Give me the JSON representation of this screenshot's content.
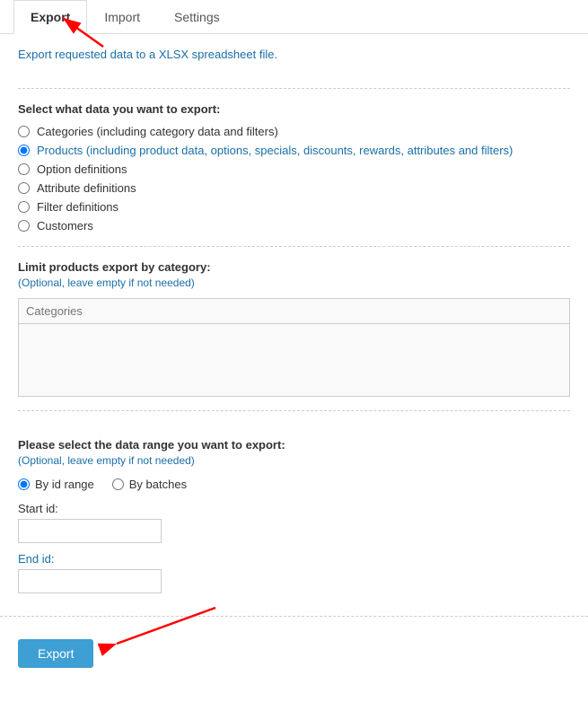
{
  "tabs": [
    {
      "id": "export",
      "label": "Export",
      "active": true
    },
    {
      "id": "import",
      "label": "Import",
      "active": false
    },
    {
      "id": "settings",
      "label": "Settings",
      "active": false
    }
  ],
  "description": "Export requested data to a XLSX spreadsheet file.",
  "export_options": {
    "label": "Select what data you want to export:",
    "options": [
      {
        "id": "categories",
        "label": "Categories (including category data and filters)",
        "selected": false
      },
      {
        "id": "products",
        "label": "Products (including product data, options, specials, discounts, rewards, attributes and filters)",
        "selected": true
      },
      {
        "id": "option_definitions",
        "label": "Option definitions",
        "selected": false
      },
      {
        "id": "attribute_definitions",
        "label": "Attribute definitions",
        "selected": false
      },
      {
        "id": "filter_definitions",
        "label": "Filter definitions",
        "selected": false
      },
      {
        "id": "customers",
        "label": "Customers",
        "selected": false
      }
    ]
  },
  "limit_section": {
    "label": "Limit products export by category:",
    "sublabel": "(Optional, leave empty if not needed)",
    "placeholder": "Categories"
  },
  "data_range": {
    "label": "Please select the data range you want to export:",
    "sublabel": "(Optional, leave empty if not needed)",
    "options": [
      {
        "id": "by_id_range",
        "label": "By id range",
        "selected": true
      },
      {
        "id": "by_batches",
        "label": "By batches",
        "selected": false
      }
    ]
  },
  "fields": {
    "start_id": {
      "label": "Start id:",
      "value": ""
    },
    "end_id": {
      "label": "End id:",
      "value": ""
    }
  },
  "export_button": "Export"
}
